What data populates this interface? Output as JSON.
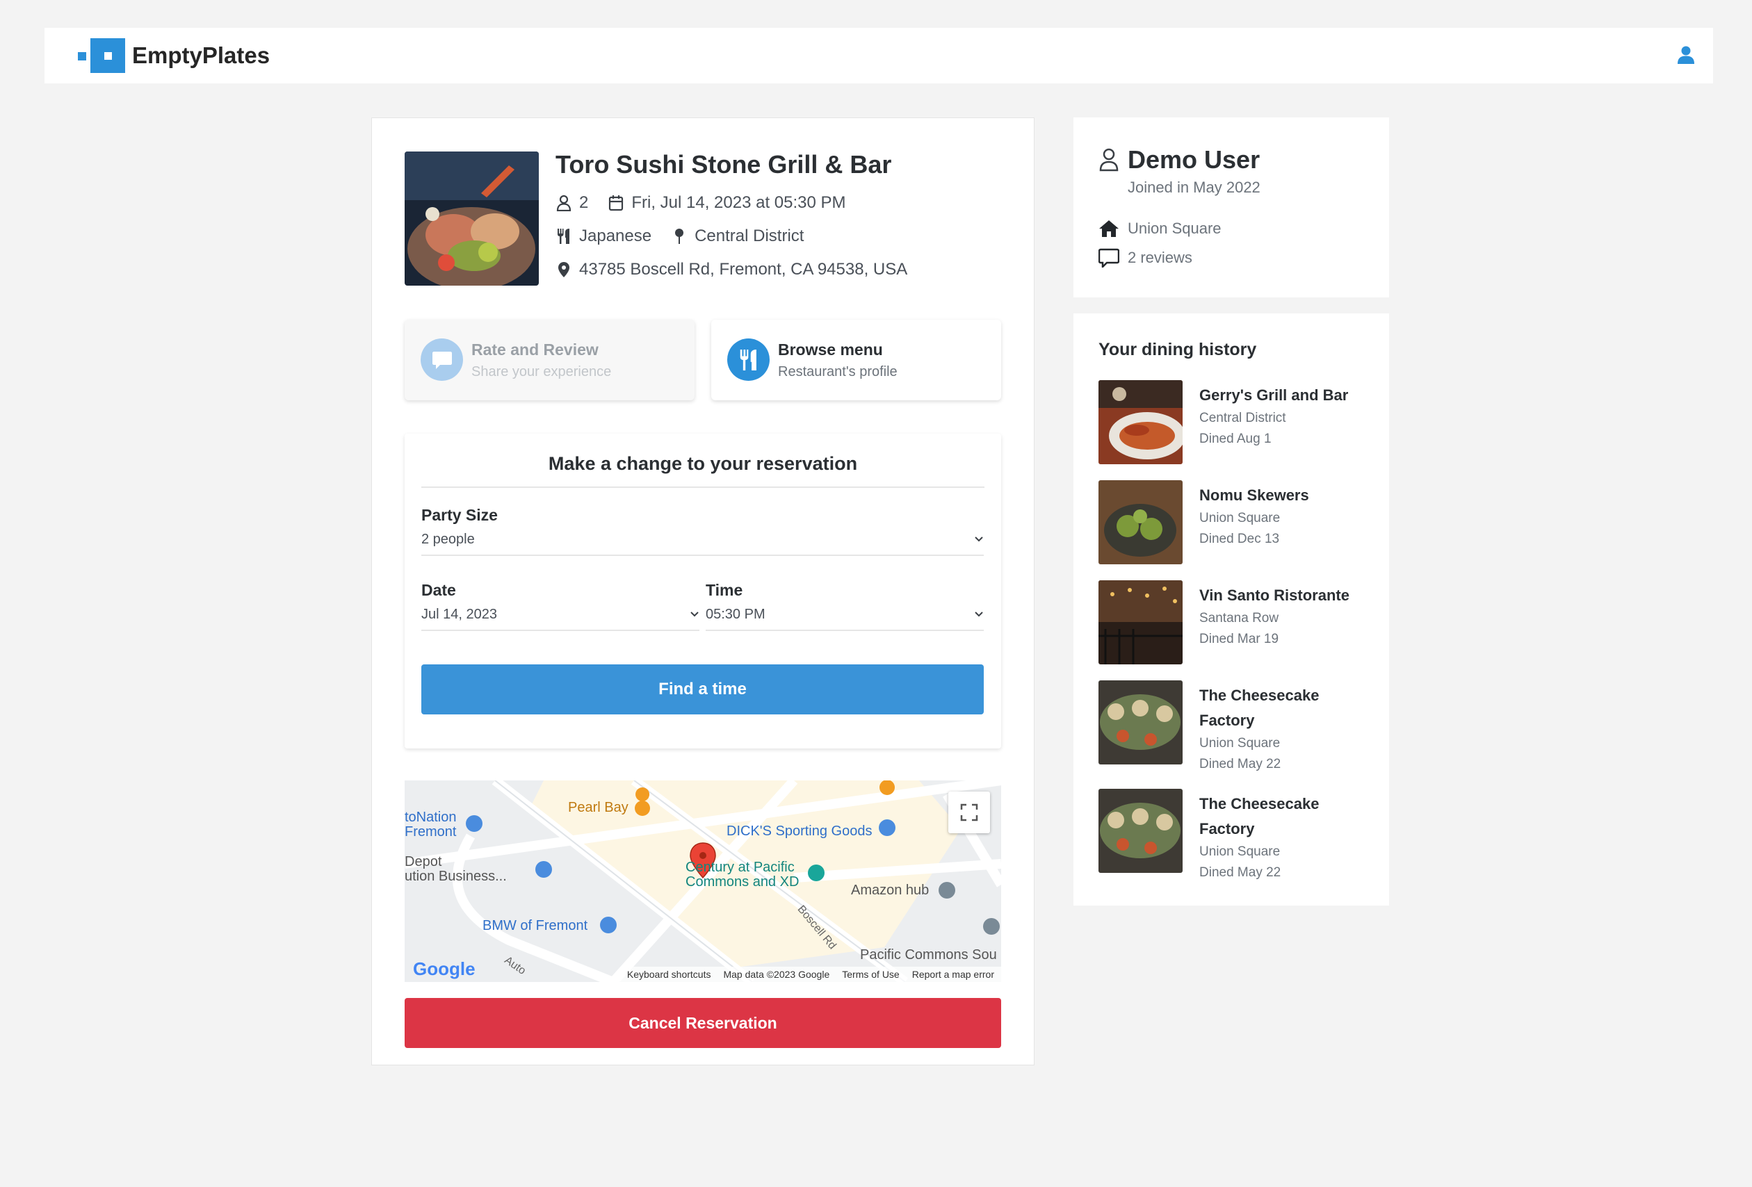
{
  "header": {
    "brand": "EmptyPlates",
    "user_icon": "user-icon"
  },
  "restaurant": {
    "name": "Toro Sushi Stone Grill & Bar",
    "party": "2",
    "datetime": "Fri, Jul 14, 2023 at 05:30 PM",
    "cuisine": "Japanese",
    "neighborhood": "Central District",
    "address": "43785 Boscell Rd, Fremont, CA 94538, USA"
  },
  "actions": {
    "review": {
      "title": "Rate and Review",
      "subtitle": "Share your experience",
      "icon": "comment-icon"
    },
    "menu": {
      "title": "Browse menu",
      "subtitle": "Restaurant's profile",
      "icon": "utensils-icon"
    }
  },
  "form": {
    "title": "Make a change to your reservation",
    "party_label": "Party Size",
    "party_value": "2 people",
    "date_label": "Date",
    "date_value": "Jul 14, 2023",
    "time_label": "Time",
    "time_value": "05:30 PM",
    "find_button": "Find a time"
  },
  "map": {
    "labels": {
      "pearl_bay": "Pearl Bay",
      "dicks": "DICK'S Sporting Goods",
      "autonation_1": "toNation",
      "autonation_2": "Fremont",
      "depot_1": "Depot",
      "depot_2": "ution Business...",
      "century_1": "Century at Pacific",
      "century_2": "Commons and XD",
      "amazon": "Amazon hub",
      "bmw": "BMW of Fremont",
      "boscell": "Boscell Rd",
      "pacific": "Pacific Commons Sou",
      "auto": "Auto",
      "google": "Google"
    },
    "footer": {
      "shortcuts": "Keyboard shortcuts",
      "data": "Map data ©2023 Google",
      "terms": "Terms of Use",
      "report": "Report a map error"
    },
    "colors": {
      "commercial": "#fdf6e3",
      "road": "#ffffff",
      "pin": "#ea4335",
      "poi_blue": "#4a8cde",
      "poi_orange": "#f29c21"
    }
  },
  "cancel_button": "Cancel Reservation",
  "profile": {
    "name": "Demo User",
    "joined": "Joined in May 2022",
    "location": "Union Square",
    "reviews": "2 reviews"
  },
  "history": {
    "title": "Your dining history",
    "items": [
      {
        "name": "Gerry's Grill and Bar",
        "area": "Central District",
        "dined": "Dined Aug 1"
      },
      {
        "name": "Nomu Skewers",
        "area": "Union Square",
        "dined": "Dined Dec 13"
      },
      {
        "name": "Vin Santo Ristorante",
        "area": "Santana Row",
        "dined": "Dined Mar 19"
      },
      {
        "name": "The Cheesecake Factory",
        "area": "Union Square",
        "dined": "Dined May 22"
      },
      {
        "name": "The Cheesecake Factory",
        "area": "Union Square",
        "dined": "Dined May 22"
      }
    ]
  },
  "colors": {
    "accent": "#3a93d8",
    "danger": "#dc3545",
    "background": "#f3f3f3"
  }
}
